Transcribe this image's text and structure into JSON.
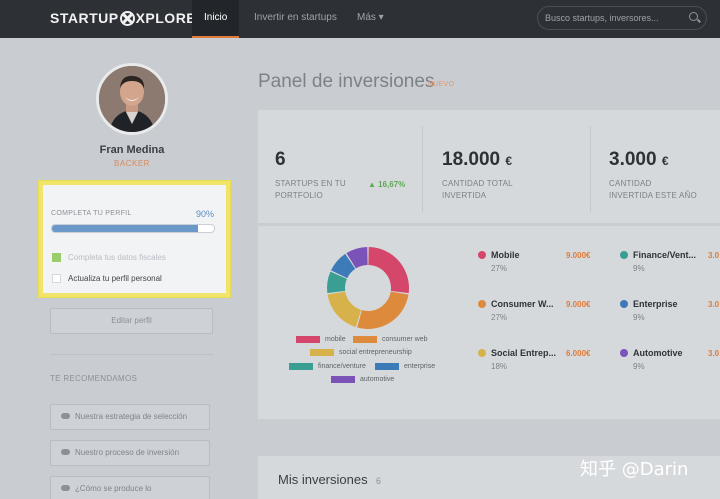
{
  "brand": {
    "pre": "STARTUP",
    "post": "XPLORE"
  },
  "nav": {
    "tabs": [
      {
        "label": "Inicio"
      },
      {
        "label": "Invertir en startups"
      },
      {
        "label": "Más ▾"
      }
    ],
    "search_placeholder": "Busco startups, inversores..."
  },
  "user": {
    "name": "Fran Medina",
    "role": "BACKER"
  },
  "profile_completion": {
    "label": "COMPLETA TU PERFIL",
    "percent_text": "90%",
    "progress": 0.9,
    "tasks": [
      {
        "label": "Completa tus datos fiscales",
        "done": true
      },
      {
        "label": "Actualiza tu perfil personal",
        "done": false
      }
    ]
  },
  "edit_profile_label": "Editar perfil",
  "recommendations": {
    "title": "TE RECOMENDAMOS",
    "items": [
      {
        "label": "Nuestra estrategia de selección"
      },
      {
        "label": "Nuestro proceso de inversión"
      },
      {
        "label": "¿Cómo se produce lo"
      }
    ]
  },
  "panel": {
    "title": "Panel de inversiones",
    "badge": "NUEVO"
  },
  "stats": [
    {
      "value": "6",
      "unit": "",
      "label_line1": "STARTUPS EN TU",
      "label_line2": "PORTFOLIO",
      "trend": "▲ 16,67%"
    },
    {
      "value": "18.000",
      "unit": "€",
      "label_line1": "CANTIDAD TOTAL",
      "label_line2": "INVERTIDA",
      "trend": ""
    },
    {
      "value": "3.000",
      "unit": "€",
      "label_line1": "CANTIDAD",
      "label_line2": "INVERTIDA ESTE AÑO",
      "trend": ""
    }
  ],
  "chart_data": {
    "type": "pie",
    "categories": [
      "mobile",
      "consumer web",
      "social entrepreneurship",
      "finance/venture",
      "enterprise",
      "automotive"
    ],
    "values": [
      27,
      27,
      18,
      9,
      9,
      9
    ],
    "colors": [
      "#d4476a",
      "#dd8a3c",
      "#d7b24a",
      "#3a9f92",
      "#3d7ab8",
      "#7a52b8"
    ]
  },
  "categories": [
    {
      "name": "Mobile",
      "pct": "27%",
      "amount": "9.000€",
      "color": "#d4476a"
    },
    {
      "name": "Finance/Vent...",
      "pct": "9%",
      "amount": "3.0",
      "color": "#3a9f92"
    },
    {
      "name": "Consumer W...",
      "pct": "27%",
      "amount": "9.000€",
      "color": "#dd8a3c"
    },
    {
      "name": "Enterprise",
      "pct": "9%",
      "amount": "3.0",
      "color": "#3d7ab8"
    },
    {
      "name": "Social Entrep...",
      "pct": "18%",
      "amount": "6.000€",
      "color": "#d7b24a"
    },
    {
      "name": "Automotive",
      "pct": "9%",
      "amount": "3.0",
      "color": "#7a52b8"
    }
  ],
  "investments": {
    "title": "Mis inversiones",
    "count": "6"
  },
  "watermark": "知乎 @Darin"
}
